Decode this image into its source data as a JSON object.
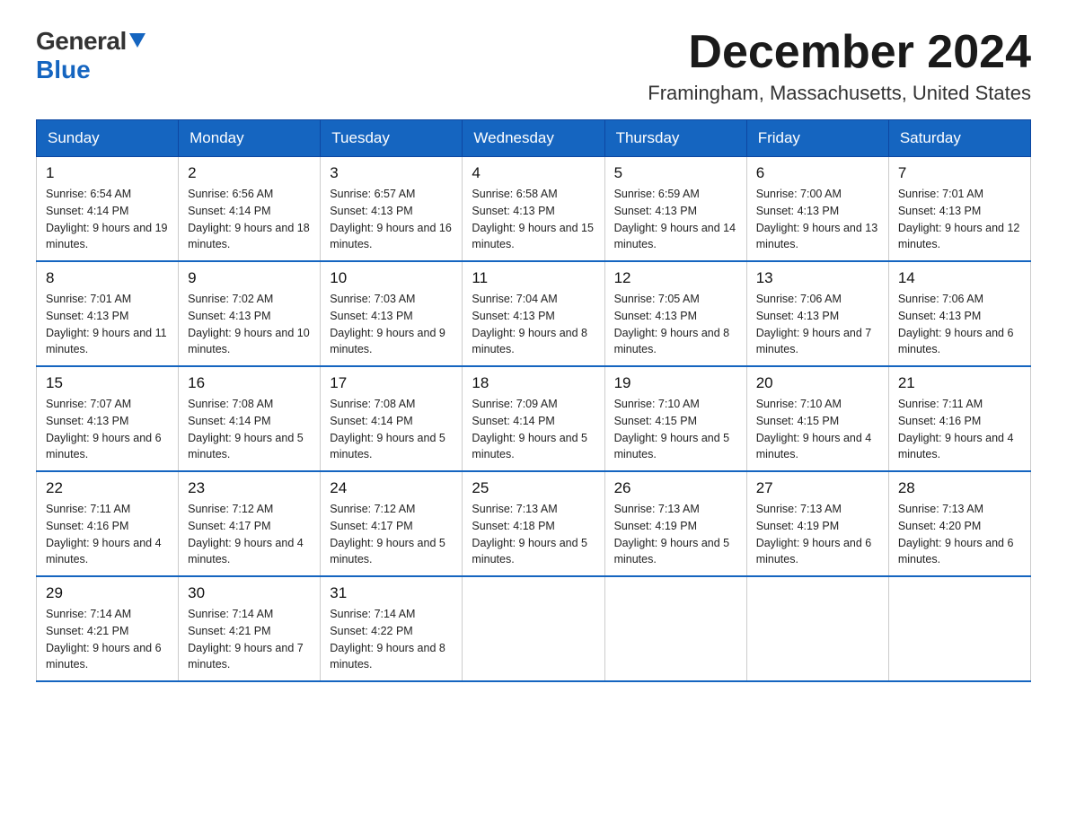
{
  "header": {
    "logo": {
      "line1": "General",
      "line2": "Blue",
      "triangle": "▶"
    },
    "title": "December 2024",
    "subtitle": "Framingham, Massachusetts, United States"
  },
  "calendar": {
    "headers": [
      "Sunday",
      "Monday",
      "Tuesday",
      "Wednesday",
      "Thursday",
      "Friday",
      "Saturday"
    ],
    "weeks": [
      [
        {
          "day": "1",
          "sunrise": "6:54 AM",
          "sunset": "4:14 PM",
          "daylight": "9 hours and 19 minutes."
        },
        {
          "day": "2",
          "sunrise": "6:56 AM",
          "sunset": "4:14 PM",
          "daylight": "9 hours and 18 minutes."
        },
        {
          "day": "3",
          "sunrise": "6:57 AM",
          "sunset": "4:13 PM",
          "daylight": "9 hours and 16 minutes."
        },
        {
          "day": "4",
          "sunrise": "6:58 AM",
          "sunset": "4:13 PM",
          "daylight": "9 hours and 15 minutes."
        },
        {
          "day": "5",
          "sunrise": "6:59 AM",
          "sunset": "4:13 PM",
          "daylight": "9 hours and 14 minutes."
        },
        {
          "day": "6",
          "sunrise": "7:00 AM",
          "sunset": "4:13 PM",
          "daylight": "9 hours and 13 minutes."
        },
        {
          "day": "7",
          "sunrise": "7:01 AM",
          "sunset": "4:13 PM",
          "daylight": "9 hours and 12 minutes."
        }
      ],
      [
        {
          "day": "8",
          "sunrise": "7:01 AM",
          "sunset": "4:13 PM",
          "daylight": "9 hours and 11 minutes."
        },
        {
          "day": "9",
          "sunrise": "7:02 AM",
          "sunset": "4:13 PM",
          "daylight": "9 hours and 10 minutes."
        },
        {
          "day": "10",
          "sunrise": "7:03 AM",
          "sunset": "4:13 PM",
          "daylight": "9 hours and 9 minutes."
        },
        {
          "day": "11",
          "sunrise": "7:04 AM",
          "sunset": "4:13 PM",
          "daylight": "9 hours and 8 minutes."
        },
        {
          "day": "12",
          "sunrise": "7:05 AM",
          "sunset": "4:13 PM",
          "daylight": "9 hours and 8 minutes."
        },
        {
          "day": "13",
          "sunrise": "7:06 AM",
          "sunset": "4:13 PM",
          "daylight": "9 hours and 7 minutes."
        },
        {
          "day": "14",
          "sunrise": "7:06 AM",
          "sunset": "4:13 PM",
          "daylight": "9 hours and 6 minutes."
        }
      ],
      [
        {
          "day": "15",
          "sunrise": "7:07 AM",
          "sunset": "4:13 PM",
          "daylight": "9 hours and 6 minutes."
        },
        {
          "day": "16",
          "sunrise": "7:08 AM",
          "sunset": "4:14 PM",
          "daylight": "9 hours and 5 minutes."
        },
        {
          "day": "17",
          "sunrise": "7:08 AM",
          "sunset": "4:14 PM",
          "daylight": "9 hours and 5 minutes."
        },
        {
          "day": "18",
          "sunrise": "7:09 AM",
          "sunset": "4:14 PM",
          "daylight": "9 hours and 5 minutes."
        },
        {
          "day": "19",
          "sunrise": "7:10 AM",
          "sunset": "4:15 PM",
          "daylight": "9 hours and 5 minutes."
        },
        {
          "day": "20",
          "sunrise": "7:10 AM",
          "sunset": "4:15 PM",
          "daylight": "9 hours and 4 minutes."
        },
        {
          "day": "21",
          "sunrise": "7:11 AM",
          "sunset": "4:16 PM",
          "daylight": "9 hours and 4 minutes."
        }
      ],
      [
        {
          "day": "22",
          "sunrise": "7:11 AM",
          "sunset": "4:16 PM",
          "daylight": "9 hours and 4 minutes."
        },
        {
          "day": "23",
          "sunrise": "7:12 AM",
          "sunset": "4:17 PM",
          "daylight": "9 hours and 4 minutes."
        },
        {
          "day": "24",
          "sunrise": "7:12 AM",
          "sunset": "4:17 PM",
          "daylight": "9 hours and 5 minutes."
        },
        {
          "day": "25",
          "sunrise": "7:13 AM",
          "sunset": "4:18 PM",
          "daylight": "9 hours and 5 minutes."
        },
        {
          "day": "26",
          "sunrise": "7:13 AM",
          "sunset": "4:19 PM",
          "daylight": "9 hours and 5 minutes."
        },
        {
          "day": "27",
          "sunrise": "7:13 AM",
          "sunset": "4:19 PM",
          "daylight": "9 hours and 6 minutes."
        },
        {
          "day": "28",
          "sunrise": "7:13 AM",
          "sunset": "4:20 PM",
          "daylight": "9 hours and 6 minutes."
        }
      ],
      [
        {
          "day": "29",
          "sunrise": "7:14 AM",
          "sunset": "4:21 PM",
          "daylight": "9 hours and 6 minutes."
        },
        {
          "day": "30",
          "sunrise": "7:14 AM",
          "sunset": "4:21 PM",
          "daylight": "9 hours and 7 minutes."
        },
        {
          "day": "31",
          "sunrise": "7:14 AM",
          "sunset": "4:22 PM",
          "daylight": "9 hours and 8 minutes."
        },
        null,
        null,
        null,
        null
      ]
    ]
  }
}
